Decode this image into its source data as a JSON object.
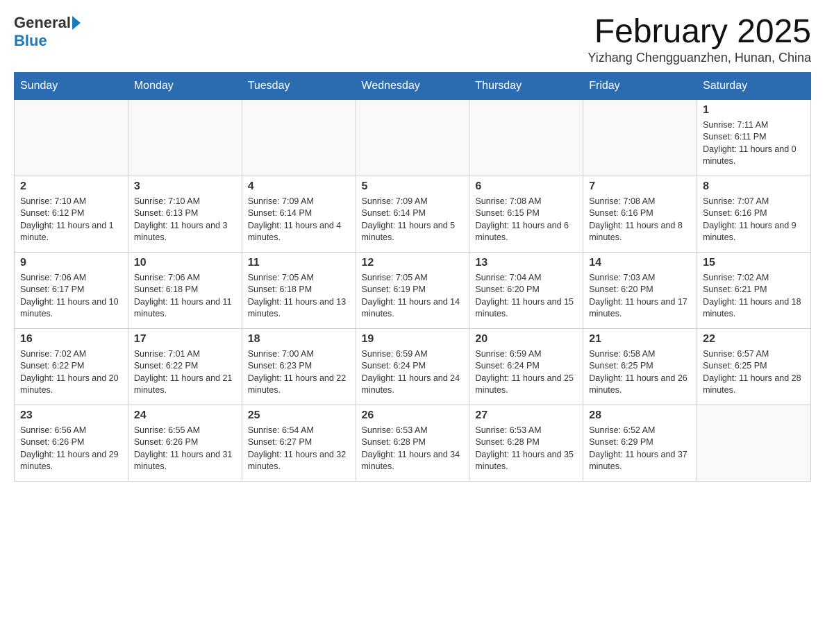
{
  "logo": {
    "general": "General",
    "blue": "Blue"
  },
  "title": "February 2025",
  "location": "Yizhang Chengguanzhen, Hunan, China",
  "days_of_week": [
    "Sunday",
    "Monday",
    "Tuesday",
    "Wednesday",
    "Thursday",
    "Friday",
    "Saturday"
  ],
  "weeks": [
    [
      {
        "day": "",
        "info": ""
      },
      {
        "day": "",
        "info": ""
      },
      {
        "day": "",
        "info": ""
      },
      {
        "day": "",
        "info": ""
      },
      {
        "day": "",
        "info": ""
      },
      {
        "day": "",
        "info": ""
      },
      {
        "day": "1",
        "info": "Sunrise: 7:11 AM\nSunset: 6:11 PM\nDaylight: 11 hours and 0 minutes."
      }
    ],
    [
      {
        "day": "2",
        "info": "Sunrise: 7:10 AM\nSunset: 6:12 PM\nDaylight: 11 hours and 1 minute."
      },
      {
        "day": "3",
        "info": "Sunrise: 7:10 AM\nSunset: 6:13 PM\nDaylight: 11 hours and 3 minutes."
      },
      {
        "day": "4",
        "info": "Sunrise: 7:09 AM\nSunset: 6:14 PM\nDaylight: 11 hours and 4 minutes."
      },
      {
        "day": "5",
        "info": "Sunrise: 7:09 AM\nSunset: 6:14 PM\nDaylight: 11 hours and 5 minutes."
      },
      {
        "day": "6",
        "info": "Sunrise: 7:08 AM\nSunset: 6:15 PM\nDaylight: 11 hours and 6 minutes."
      },
      {
        "day": "7",
        "info": "Sunrise: 7:08 AM\nSunset: 6:16 PM\nDaylight: 11 hours and 8 minutes."
      },
      {
        "day": "8",
        "info": "Sunrise: 7:07 AM\nSunset: 6:16 PM\nDaylight: 11 hours and 9 minutes."
      }
    ],
    [
      {
        "day": "9",
        "info": "Sunrise: 7:06 AM\nSunset: 6:17 PM\nDaylight: 11 hours and 10 minutes."
      },
      {
        "day": "10",
        "info": "Sunrise: 7:06 AM\nSunset: 6:18 PM\nDaylight: 11 hours and 11 minutes."
      },
      {
        "day": "11",
        "info": "Sunrise: 7:05 AM\nSunset: 6:18 PM\nDaylight: 11 hours and 13 minutes."
      },
      {
        "day": "12",
        "info": "Sunrise: 7:05 AM\nSunset: 6:19 PM\nDaylight: 11 hours and 14 minutes."
      },
      {
        "day": "13",
        "info": "Sunrise: 7:04 AM\nSunset: 6:20 PM\nDaylight: 11 hours and 15 minutes."
      },
      {
        "day": "14",
        "info": "Sunrise: 7:03 AM\nSunset: 6:20 PM\nDaylight: 11 hours and 17 minutes."
      },
      {
        "day": "15",
        "info": "Sunrise: 7:02 AM\nSunset: 6:21 PM\nDaylight: 11 hours and 18 minutes."
      }
    ],
    [
      {
        "day": "16",
        "info": "Sunrise: 7:02 AM\nSunset: 6:22 PM\nDaylight: 11 hours and 20 minutes."
      },
      {
        "day": "17",
        "info": "Sunrise: 7:01 AM\nSunset: 6:22 PM\nDaylight: 11 hours and 21 minutes."
      },
      {
        "day": "18",
        "info": "Sunrise: 7:00 AM\nSunset: 6:23 PM\nDaylight: 11 hours and 22 minutes."
      },
      {
        "day": "19",
        "info": "Sunrise: 6:59 AM\nSunset: 6:24 PM\nDaylight: 11 hours and 24 minutes."
      },
      {
        "day": "20",
        "info": "Sunrise: 6:59 AM\nSunset: 6:24 PM\nDaylight: 11 hours and 25 minutes."
      },
      {
        "day": "21",
        "info": "Sunrise: 6:58 AM\nSunset: 6:25 PM\nDaylight: 11 hours and 26 minutes."
      },
      {
        "day": "22",
        "info": "Sunrise: 6:57 AM\nSunset: 6:25 PM\nDaylight: 11 hours and 28 minutes."
      }
    ],
    [
      {
        "day": "23",
        "info": "Sunrise: 6:56 AM\nSunset: 6:26 PM\nDaylight: 11 hours and 29 minutes."
      },
      {
        "day": "24",
        "info": "Sunrise: 6:55 AM\nSunset: 6:26 PM\nDaylight: 11 hours and 31 minutes."
      },
      {
        "day": "25",
        "info": "Sunrise: 6:54 AM\nSunset: 6:27 PM\nDaylight: 11 hours and 32 minutes."
      },
      {
        "day": "26",
        "info": "Sunrise: 6:53 AM\nSunset: 6:28 PM\nDaylight: 11 hours and 34 minutes."
      },
      {
        "day": "27",
        "info": "Sunrise: 6:53 AM\nSunset: 6:28 PM\nDaylight: 11 hours and 35 minutes."
      },
      {
        "day": "28",
        "info": "Sunrise: 6:52 AM\nSunset: 6:29 PM\nDaylight: 11 hours and 37 minutes."
      },
      {
        "day": "",
        "info": ""
      }
    ]
  ]
}
